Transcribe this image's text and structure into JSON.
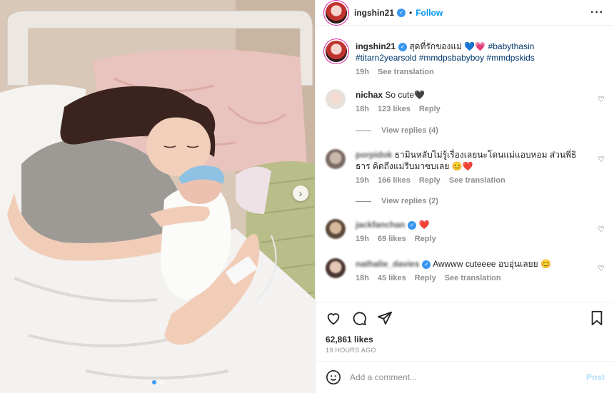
{
  "colors": {
    "accent": "#0095f6",
    "verified": "#3897f0",
    "muted": "#8e8e8e"
  },
  "header": {
    "username": "ingshin21",
    "separator": "•",
    "follow_label": "Follow",
    "more_icon": "more-horizontal-icon"
  },
  "caption": {
    "username": "ingshin21",
    "text": "สุดที่รักของแม่ 💙💗",
    "hashtags": "#babythasin #titarn2yearsold #mmdpsbabyboy #mmdpskids",
    "time": "19h",
    "translate": "See translation"
  },
  "comments": [
    {
      "username": "nichax",
      "text": "So cute🖤",
      "time": "18h",
      "likes": "123 likes",
      "reply": "Reply",
      "view_replies": "View replies (4)"
    },
    {
      "username": "porpidok",
      "text": "ธามินหลับไม่รู้เรื่องเลยนะโดนแม่แอบหอม ส่วนพี่ธิธาร คิดถึงแม่รีบมาซบเลย 😊❤️",
      "time": "19h",
      "likes": "166 likes",
      "reply": "Reply",
      "translate": "See translation",
      "view_replies": "View replies (2)"
    },
    {
      "username": "jackfanchan",
      "text": "❤️",
      "time": "19h",
      "likes": "69 likes",
      "reply": "Reply"
    },
    {
      "username": "nathalie_davies",
      "text": "Awwww cuteeee อบอุ่นเลยย 😊",
      "time": "18h",
      "likes": "45 likes",
      "reply": "Reply",
      "translate": "See translation"
    }
  ],
  "actions": {
    "likes": "62,861 likes",
    "ago": "19 HOURS AGO"
  },
  "add_comment": {
    "placeholder": "Add a comment...",
    "post_label": "Post"
  },
  "carousel": {
    "slides": 2,
    "active": 1
  }
}
